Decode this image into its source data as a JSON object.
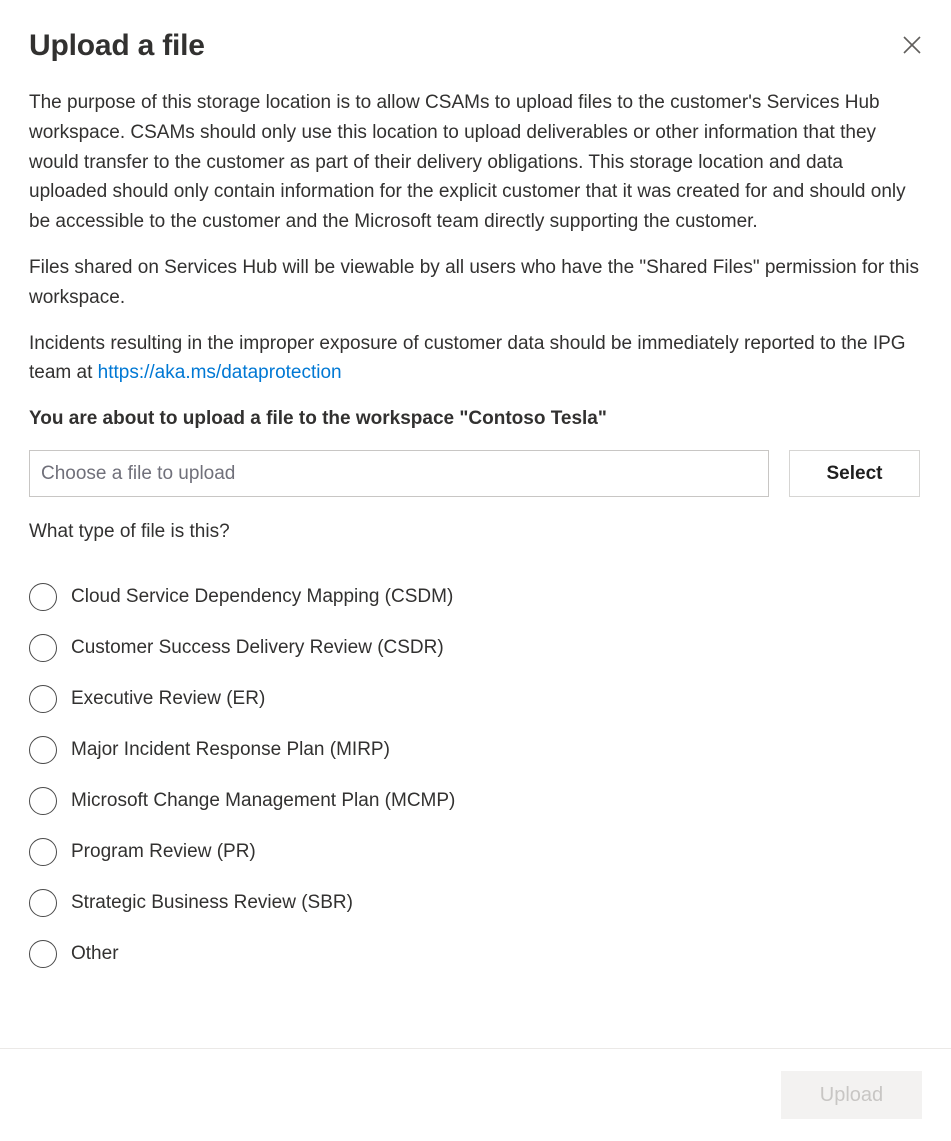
{
  "dialog": {
    "title": "Upload a file",
    "close_icon_label": "close-icon"
  },
  "body": {
    "paragraph_1": "The purpose of this storage location is to allow CSAMs to upload files to the customer's Services Hub workspace. CSAMs should only use this location to upload deliverables or other information that they would transfer to the customer as part of their delivery obligations. This storage location and data uploaded should only contain information for the explicit customer that it was created for and should only be accessible to the customer and the Microsoft team directly supporting the customer.",
    "paragraph_2": "Files shared on Services Hub will be viewable by all users who have the \"Shared Files\" permission for this workspace.",
    "paragraph_3_prefix": "Incidents resulting in the improper exposure of customer data should be immediately reported to the IPG team at ",
    "paragraph_3_link": "https://aka.ms/dataprotection",
    "workspace_note": "You are about to upload a file to the workspace \"Contoso Tesla\""
  },
  "file_picker": {
    "input_value": "",
    "input_placeholder": "Choose a file to upload",
    "select_label": "Select"
  },
  "file_type": {
    "question": "What type of file is this?",
    "selected": null,
    "options": [
      {
        "label": "Cloud Service Dependency Mapping (CSDM)"
      },
      {
        "label": "Customer Success Delivery Review (CSDR)"
      },
      {
        "label": "Executive Review (ER)"
      },
      {
        "label": "Major Incident Response Plan (MIRP)"
      },
      {
        "label": "Microsoft Change Management Plan (MCMP)"
      },
      {
        "label": "Program Review (PR)"
      },
      {
        "label": "Strategic Business Review (SBR)"
      },
      {
        "label": "Other"
      }
    ]
  },
  "footer": {
    "upload_label": "Upload",
    "upload_disabled": true
  },
  "colors": {
    "text": "#323130",
    "link": "#0078d4",
    "border": "#c8c6c4",
    "disabled_bg": "#f3f2f1",
    "disabled_text": "#c8c6c4"
  }
}
